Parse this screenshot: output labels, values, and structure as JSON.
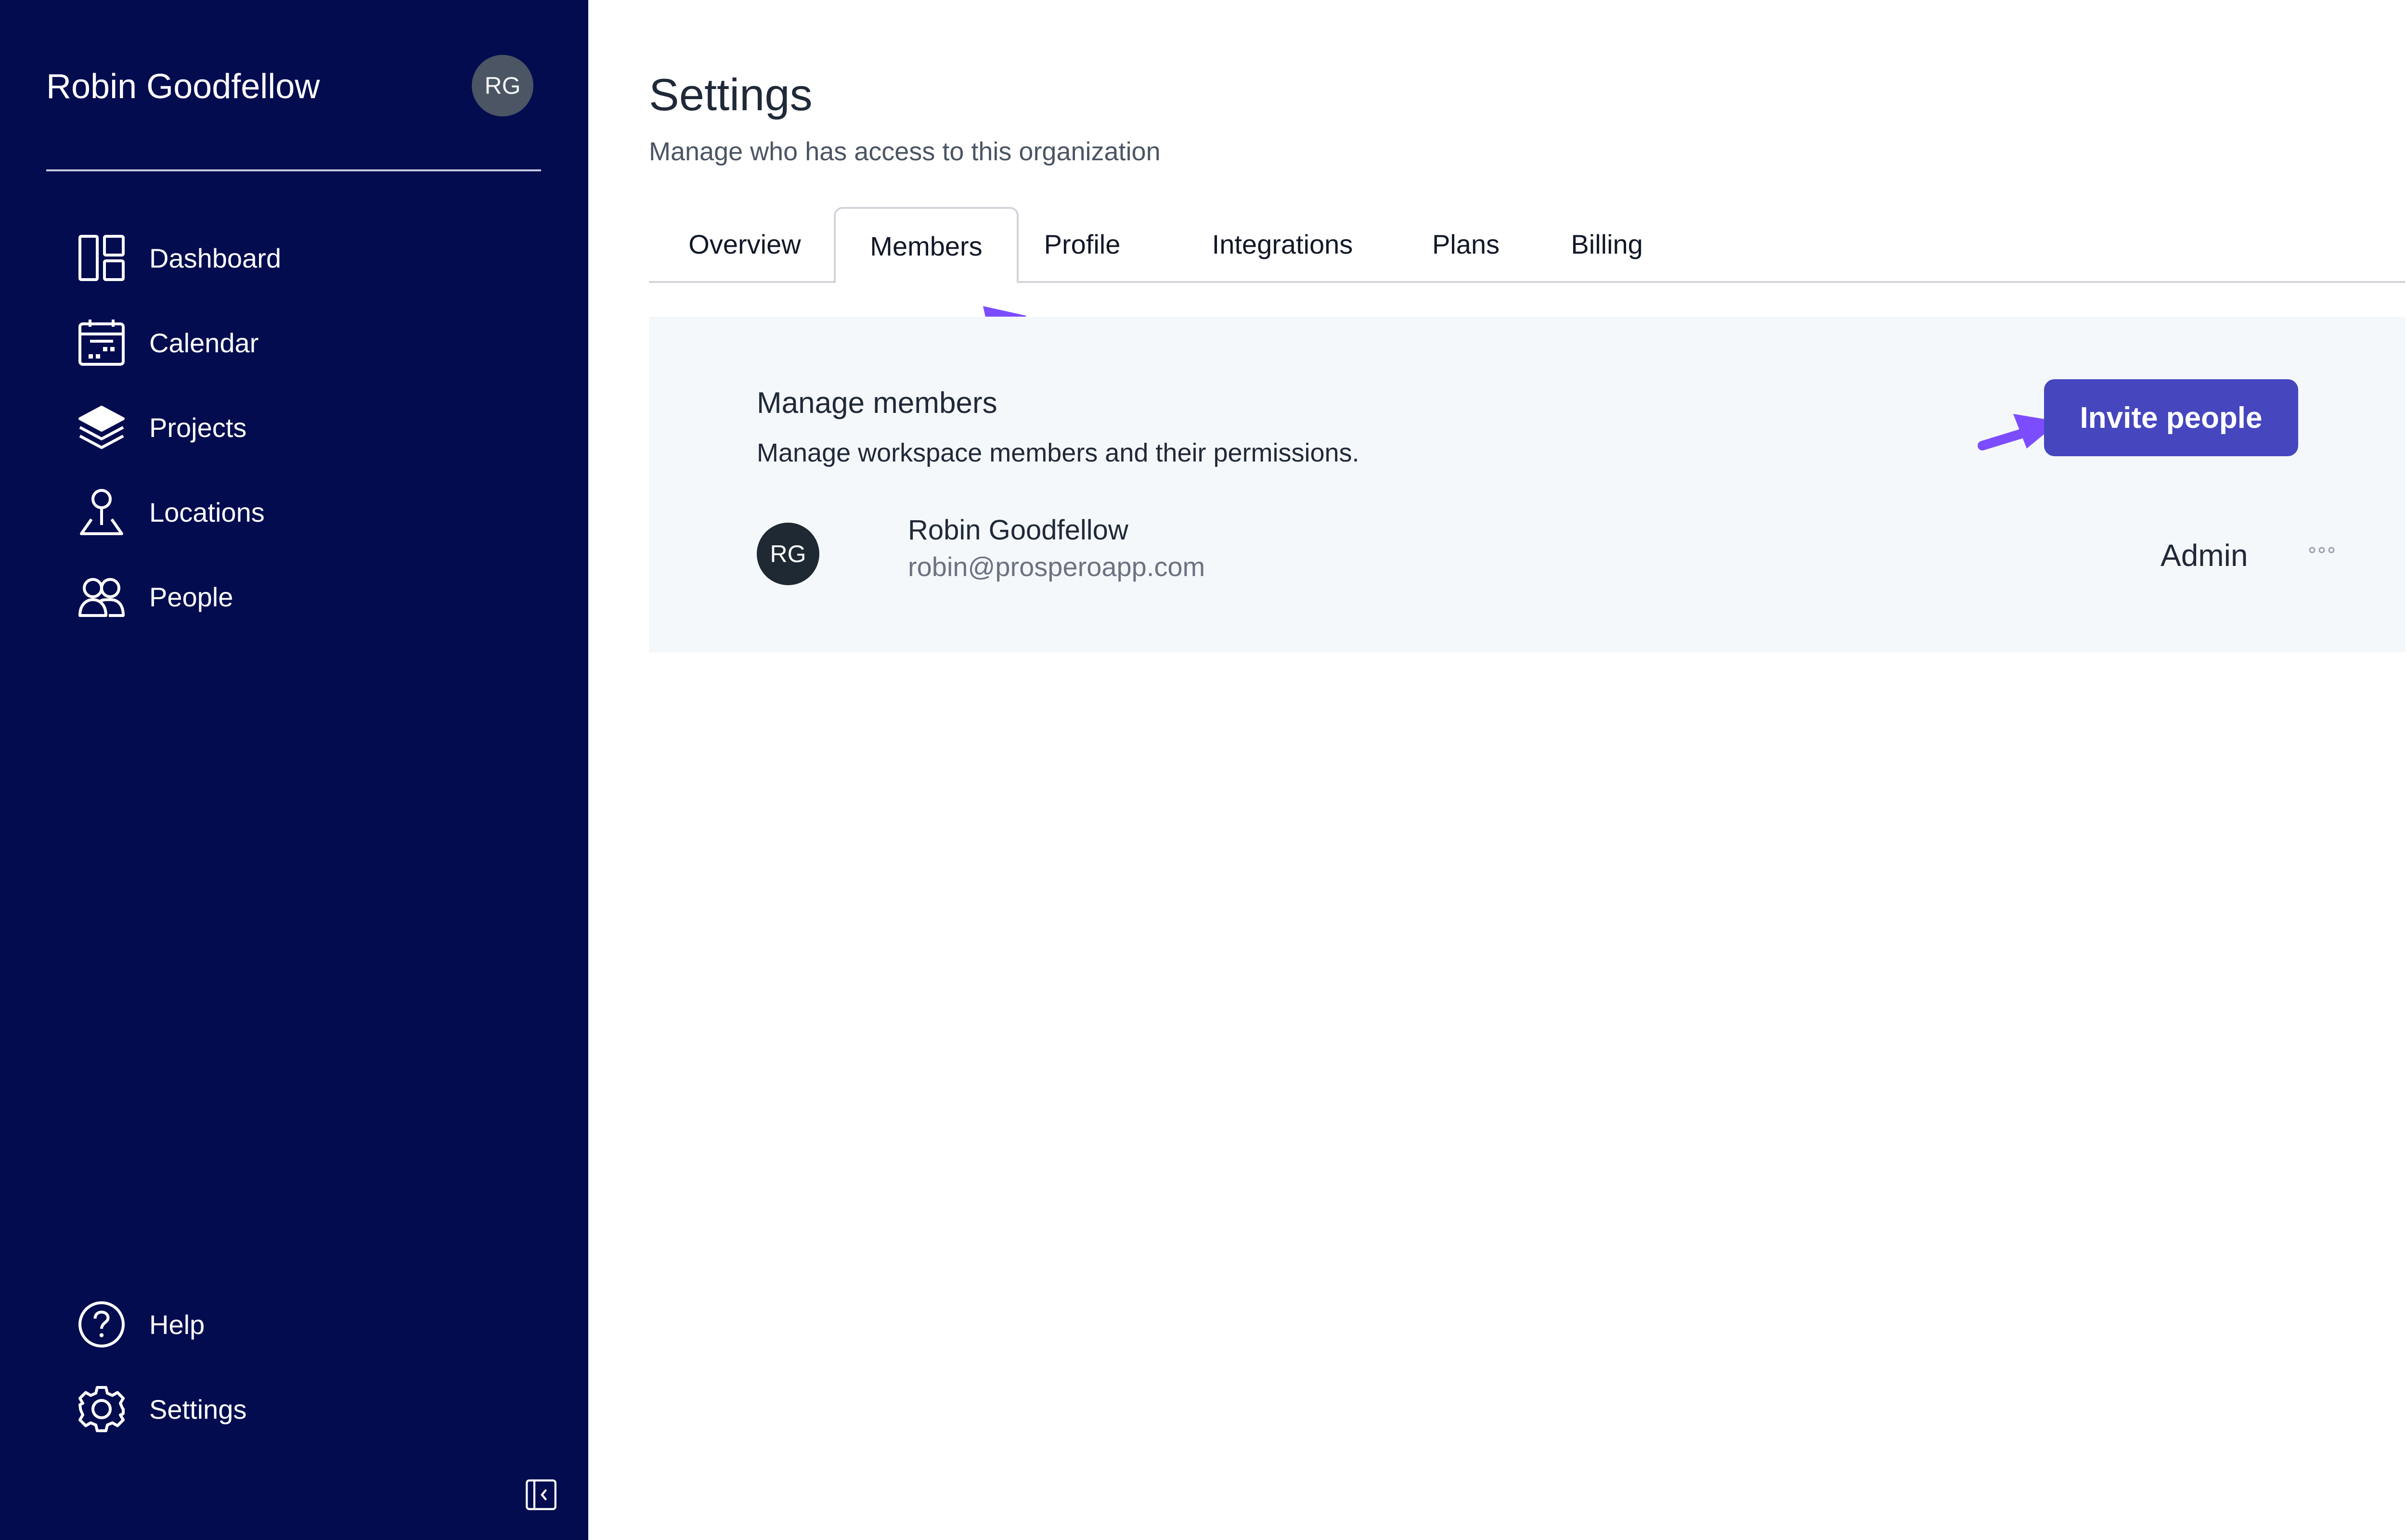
{
  "sidebar": {
    "user_name": "Robin Goodfellow",
    "user_initials": "RG",
    "items": [
      {
        "label": "Dashboard",
        "icon": "dashboard-icon"
      },
      {
        "label": "Calendar",
        "icon": "calendar-icon"
      },
      {
        "label": "Projects",
        "icon": "layers-icon"
      },
      {
        "label": "Locations",
        "icon": "location-pin-icon"
      },
      {
        "label": "People",
        "icon": "people-icon"
      }
    ],
    "bottom_items": [
      {
        "label": "Help",
        "icon": "help-icon"
      },
      {
        "label": "Settings",
        "icon": "gear-icon"
      }
    ],
    "collapse_icon": "collapse-sidebar-icon"
  },
  "header": {
    "title": "Settings",
    "subtitle": "Manage who has access to this organization"
  },
  "tabs": [
    {
      "label": "Overview",
      "active": false
    },
    {
      "label": "Members",
      "active": true
    },
    {
      "label": "Profile",
      "active": false
    },
    {
      "label": "Integrations",
      "active": false
    },
    {
      "label": "Plans",
      "active": false
    },
    {
      "label": "Billing",
      "active": false
    }
  ],
  "members_card": {
    "title": "Manage members",
    "description": "Manage workspace members and their permissions.",
    "invite_label": "Invite people",
    "members": [
      {
        "initials": "RG",
        "name": "Robin Goodfellow",
        "email": "robin@prosperoapp.com",
        "role": "Admin"
      }
    ]
  },
  "colors": {
    "sidebar_bg": "#030c4f",
    "primary_button": "#4646bf",
    "annotation_arrow": "#7c4dff",
    "card_bg": "#f5f8fb"
  }
}
